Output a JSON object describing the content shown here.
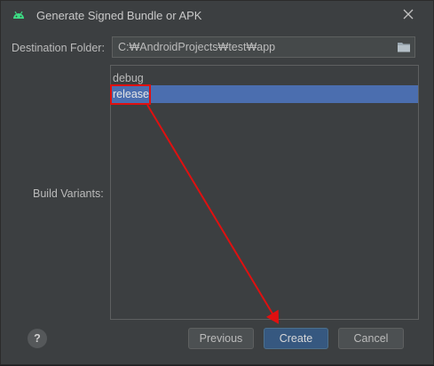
{
  "window": {
    "title": "Generate Signed Bundle or APK",
    "icon": "android-icon",
    "close_icon": "close-icon"
  },
  "destination": {
    "label": "Destination Folder:",
    "value": "C:₩AndroidProjects₩test₩app",
    "browse_icon": "folder-icon"
  },
  "build_variants": {
    "label": "Build Variants:",
    "items": [
      "debug",
      "release"
    ],
    "selected": "release"
  },
  "buttons": {
    "help": "?",
    "previous": "Previous",
    "create": "Create",
    "cancel": "Cancel"
  },
  "colors": {
    "background": "#3c3f41",
    "selection": "#4b6eaf",
    "primary_button": "#365880",
    "annotation": "#e01010"
  }
}
